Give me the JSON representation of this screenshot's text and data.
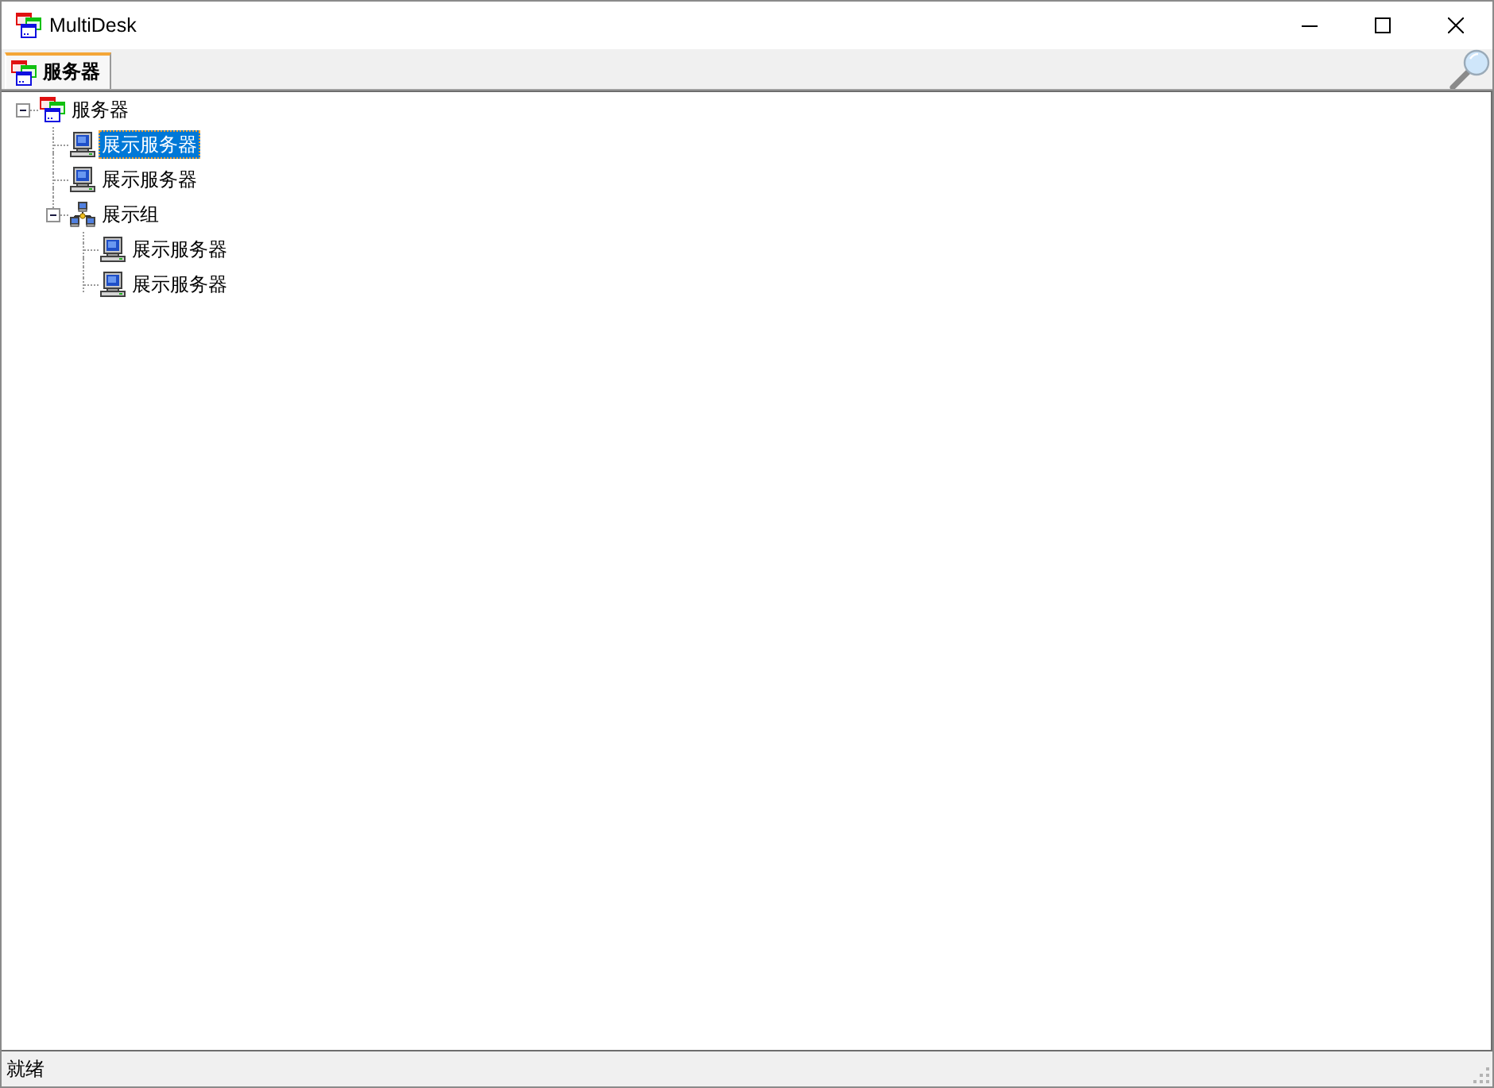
{
  "window": {
    "title": "MultiDesk"
  },
  "tabs": [
    {
      "label": "服务器",
      "selected": true
    }
  ],
  "tree": [
    {
      "kind": "root",
      "label": "服务器",
      "expanded": true,
      "selected": false,
      "children": [
        {
          "kind": "server",
          "label": "展示服务器",
          "selected": true
        },
        {
          "kind": "server",
          "label": "展示服务器",
          "selected": false
        },
        {
          "kind": "group",
          "label": "展示组",
          "expanded": true,
          "selected": false,
          "children": [
            {
              "kind": "server",
              "label": "展示服务器",
              "selected": false
            },
            {
              "kind": "server",
              "label": "展示服务器",
              "selected": false
            }
          ]
        }
      ]
    }
  ],
  "status_bar": {
    "text": "就绪"
  }
}
